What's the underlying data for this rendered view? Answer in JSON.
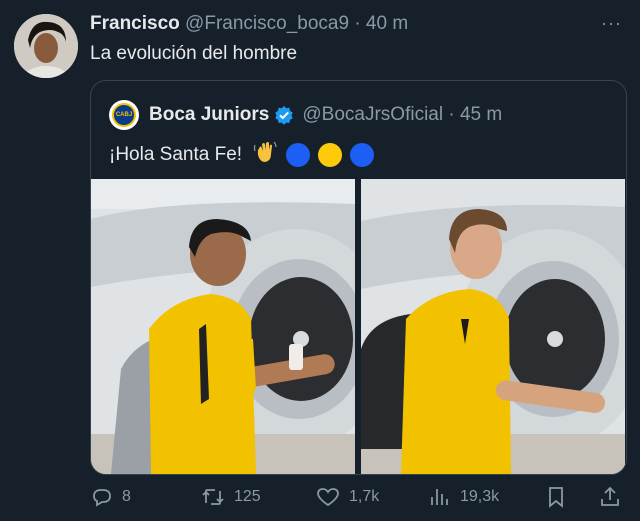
{
  "tweet": {
    "author_name": "Francisco",
    "author_handle": "@Francisco_boca9",
    "separator": "·",
    "time": "40 m",
    "text": "La evolución del hombre",
    "more_label": "···"
  },
  "quoted": {
    "author_name": "Boca Juniors",
    "author_handle": "@BocaJrsOficial",
    "separator": "·",
    "time": "45 m",
    "text": "¡Hola Santa Fe!",
    "logo_text": "CABJ",
    "emojis": [
      "waving-hand",
      "blue-circle",
      "yellow-circle",
      "blue-circle"
    ]
  },
  "actions": {
    "replies": "8",
    "retweets": "125",
    "likes": "1,7k",
    "views": "19,3k"
  },
  "colors": {
    "background": "#15202b",
    "text": "#e7e9ea",
    "muted": "#8b98a5",
    "border": "#38444d",
    "verified": "#1d9bf0",
    "boca_blue": "#0a3a8a",
    "boca_yellow": "#f2c200"
  }
}
